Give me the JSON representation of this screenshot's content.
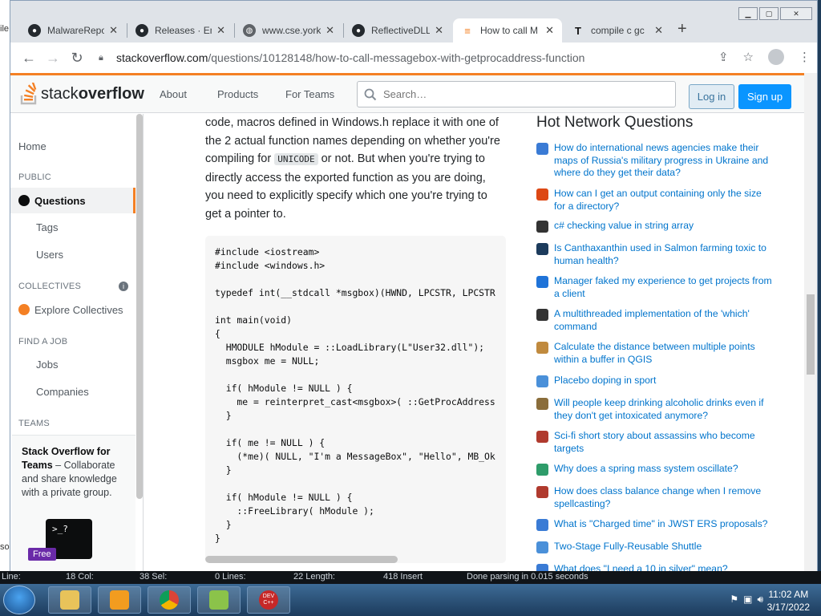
{
  "desktop": {
    "left_edge_text_top": "ile",
    "left_edge_text_bottom": "so"
  },
  "browser": {
    "tabs": [
      {
        "label": "MalwareRepo",
        "icon": "github-icon"
      },
      {
        "label": "Releases · Em",
        "icon": "github-icon"
      },
      {
        "label": "www.cse.york",
        "icon": "globe-icon"
      },
      {
        "label": "ReflectiveDLL",
        "icon": "github-icon"
      },
      {
        "label": "How to call M",
        "icon": "stackoverflow-icon"
      },
      {
        "label": "compile c gc",
        "icon": "t-icon"
      }
    ],
    "active_tab_index": 4,
    "url_host": "stackoverflow.com",
    "url_path": "/questions/10128148/how-to-call-messagebox-with-getprocaddress-function"
  },
  "so": {
    "logo_light": "stack",
    "logo_bold": "overflow",
    "nav": {
      "about": "About",
      "products": "Products",
      "for_teams": "For Teams"
    },
    "search_placeholder": "Search…",
    "login": "Log in",
    "signup": "Sign up"
  },
  "leftnav": {
    "home": "Home",
    "public_head": "PUBLIC",
    "questions": "Questions",
    "tags": "Tags",
    "users": "Users",
    "collectives_head": "COLLECTIVES",
    "explore_collectives": "Explore Collectives",
    "find_job_head": "FIND A JOB",
    "jobs": "Jobs",
    "companies": "Companies",
    "teams_head": "TEAMS",
    "teams_title": "Stack Overflow for Teams",
    "teams_body": " – Collaborate and share knowledge with a private group.",
    "free_badge": "Free",
    "terminal_text": ">_?"
  },
  "answer": {
    "p1": "code, macros defined in Windows.h replace it with one of the 2 actual function names depending on whether you're compiling for ",
    "p1_code": "UNICODE",
    "p2": " or not. But when you're trying to directly access the exported function as you are doing, you need to explicitly specify which one you're trying to get a pointer to.",
    "code_lines": [
      "#include <iostream>",
      "#include <windows.h>",
      "",
      "typedef int(__stdcall *msgbox)(HWND, LPCSTR, LPCSTR",
      "",
      "int main(void)",
      "{",
      "  HMODULE hModule = ::LoadLibrary(L\"User32.dll\");",
      "  msgbox me = NULL;",
      "",
      "  if( hModule != NULL ) {",
      "    me = reinterpret_cast<msgbox>( ::GetProcAddress",
      "  }",
      "",
      "  if( me != NULL ) {",
      "    (*me)( NULL, \"I'm a MessageBox\", \"Hello\", MB_Ok",
      "  }",
      "",
      "  if( hModule != NULL ) {",
      "    ::FreeLibrary( hModule );",
      "  }",
      "}"
    ]
  },
  "hnq": {
    "title": "Hot Network Questions",
    "items": [
      {
        "text": "How do international news agencies make their maps of Russia's military progress in Ukraine and where do they get their data?",
        "icon": "politics-icon",
        "color": "#3a7bd5"
      },
      {
        "text": "How can I get an output containing only the size for a directory?",
        "icon": "askubuntu-icon",
        "color": "#dd4814"
      },
      {
        "text": "c# checking value in string array",
        "icon": "codereview-icon",
        "color": "#333333"
      },
      {
        "text": "Is Canthaxanthin used in Salmon farming toxic to human health?",
        "icon": "skeptics-icon",
        "color": "#1c3b5c"
      },
      {
        "text": "Manager faked my experience to get projects from a client",
        "icon": "workplace-icon",
        "color": "#1f73d8"
      },
      {
        "text": "A multithreaded implementation of the 'which' command",
        "icon": "codereview-icon",
        "color": "#333333"
      },
      {
        "text": "Calculate the distance between multiple points within a buffer in QGIS",
        "icon": "gis-icon",
        "color": "#c08a3e"
      },
      {
        "text": "Placebo doping in sport",
        "icon": "sports-icon",
        "color": "#4a90d9"
      },
      {
        "text": "Will people keep drinking alcoholic drinks even if they don't get intoxicated anymore?",
        "icon": "worldbuilding-icon",
        "color": "#8a6d3b"
      },
      {
        "text": "Sci-fi short story about assassins who become targets",
        "icon": "scifi-icon",
        "color": "#b03a2e"
      },
      {
        "text": "Why does a spring mass system oscillate?",
        "icon": "physics-icon",
        "color": "#2e9c6a"
      },
      {
        "text": "How does class balance change when I remove spellcasting?",
        "icon": "rpg-icon",
        "color": "#b03a2e"
      },
      {
        "text": "What is \"Charged time\" in JWST ERS proposals?",
        "icon": "astronomy-icon",
        "color": "#3a7bd5"
      },
      {
        "text": "Two-Stage Fully-Reusable Shuttle",
        "icon": "space-icon",
        "color": "#4a90d9"
      },
      {
        "text": "What does \"I need a 10 in silver\" mean?",
        "icon": "ell-icon",
        "color": "#3a7bd5"
      }
    ]
  },
  "status_strip": {
    "line": "Line:",
    "col": "18 Col:",
    "sel": "38 Sel:",
    "lines": "0 Lines:",
    "length": "22 Length:",
    "insert": "418 Insert",
    "parsing": "Done parsing in 0.015 seconds"
  },
  "taskbar": {
    "apps": [
      "explorer-icon",
      "media-player-icon",
      "chrome-icon",
      "notepad-icon",
      "devcpp-icon"
    ],
    "devcpp_label": "DEV C++",
    "time": "11:02 AM",
    "date": "3/17/2022"
  }
}
